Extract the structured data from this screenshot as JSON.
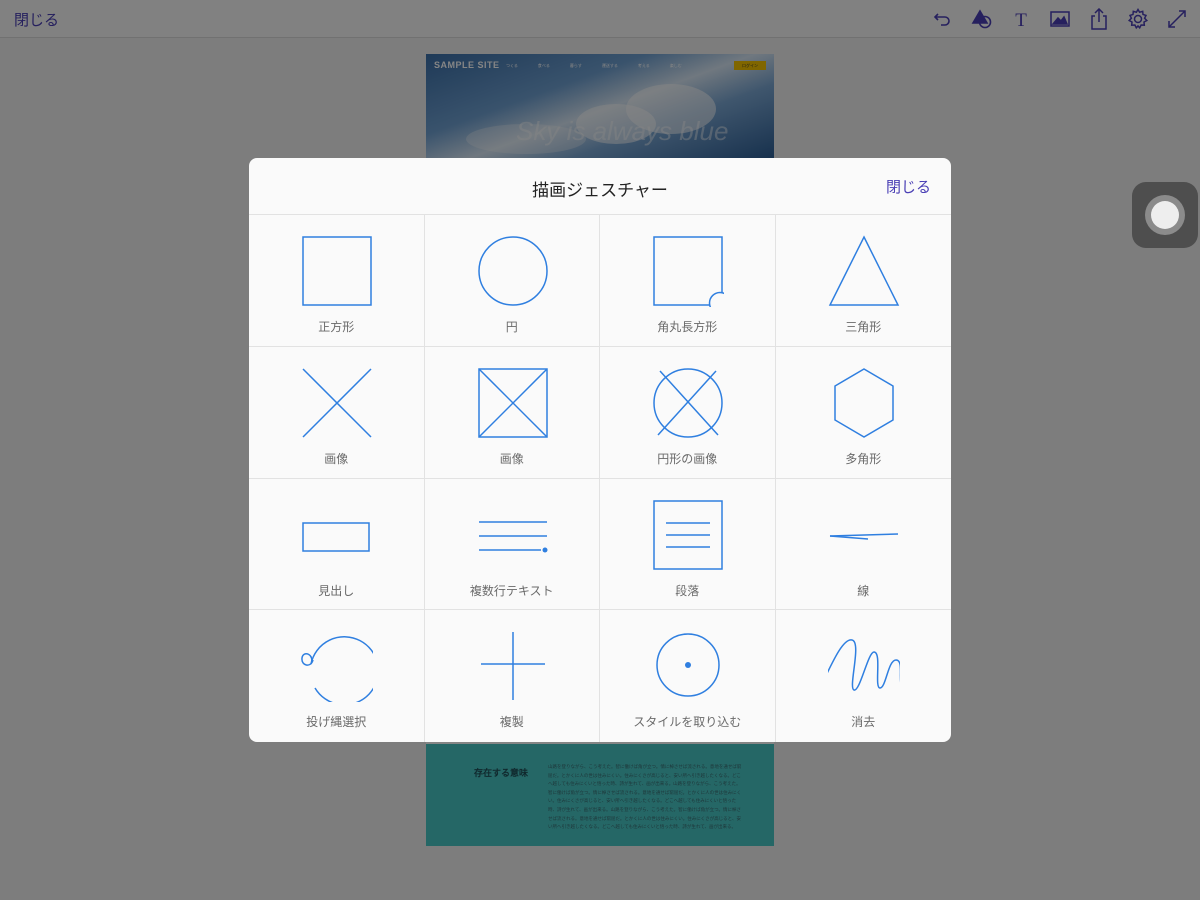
{
  "topbar": {
    "close_label": "閉じる",
    "icons": [
      "undo-icon",
      "shapes-icon",
      "text-icon",
      "image-icon",
      "share-icon",
      "settings-icon",
      "fullscreen-icon"
    ],
    "accent_color": "#4a3fb5"
  },
  "document": {
    "logo": "SAMPLE SITE",
    "nav_items": [
      "つくる",
      "食べる",
      "暮らす",
      "運送する",
      "考える",
      "楽しむ"
    ],
    "nav_button": "ログイン",
    "tagline": "Sky is always blue",
    "section_title": "存在する意味",
    "section_body": "山路を登りながら、こう考えた。智に働けば角が立つ。情に棹させば流される。意地を通せば窮屈だ。とかくに人の世は住みにくい。住みにくさが高じると、安い所へ引き越したくなる。どこへ越しても住みにくいと悟った時、詩が生れて、画が出来る。山路を登りながら、こう考えた。智に働けば角が立つ。情に棹させば流される。意地を通せば窮屈だ。とかくに人の世は住みにくい。住みにくさが高じると、安い所へ引き越したくなる。どこへ越しても住みにくいと悟った時、詩が生れて、画が出来る。山路を登りながら、こう考えた。智に働けば角が立つ。情に棹させば流される。意地を通せば窮屈だ。とかくに人の世は住みにくい。住みにくさが高じると、安い所へ引き越したくなる。どこへ越しても住みにくいと悟った時、詩が生れて、画が出来る。"
  },
  "modal": {
    "title": "描画ジェスチャー",
    "close_label": "閉じる",
    "stroke_color": "#2f7fe0",
    "gestures": [
      {
        "label": "正方形",
        "icon": "square-gesture-icon"
      },
      {
        "label": "円",
        "icon": "circle-gesture-icon"
      },
      {
        "label": "角丸長方形",
        "icon": "rounded-rectangle-gesture-icon"
      },
      {
        "label": "三角形",
        "icon": "triangle-gesture-icon"
      },
      {
        "label": "画像",
        "icon": "x-image-gesture-icon"
      },
      {
        "label": "画像",
        "icon": "boxed-x-image-gesture-icon"
      },
      {
        "label": "円形の画像",
        "icon": "circle-image-gesture-icon"
      },
      {
        "label": "多角形",
        "icon": "hexagon-gesture-icon"
      },
      {
        "label": "見出し",
        "icon": "heading-gesture-icon"
      },
      {
        "label": "複数行テキスト",
        "icon": "multiline-text-gesture-icon"
      },
      {
        "label": "段落",
        "icon": "paragraph-gesture-icon"
      },
      {
        "label": "線",
        "icon": "line-gesture-icon"
      },
      {
        "label": "投げ縄選択",
        "icon": "lasso-gesture-icon"
      },
      {
        "label": "複製",
        "icon": "duplicate-gesture-icon"
      },
      {
        "label": "スタイルを取り込む",
        "icon": "import-style-gesture-icon"
      },
      {
        "label": "消去",
        "icon": "erase-gesture-icon"
      }
    ]
  }
}
